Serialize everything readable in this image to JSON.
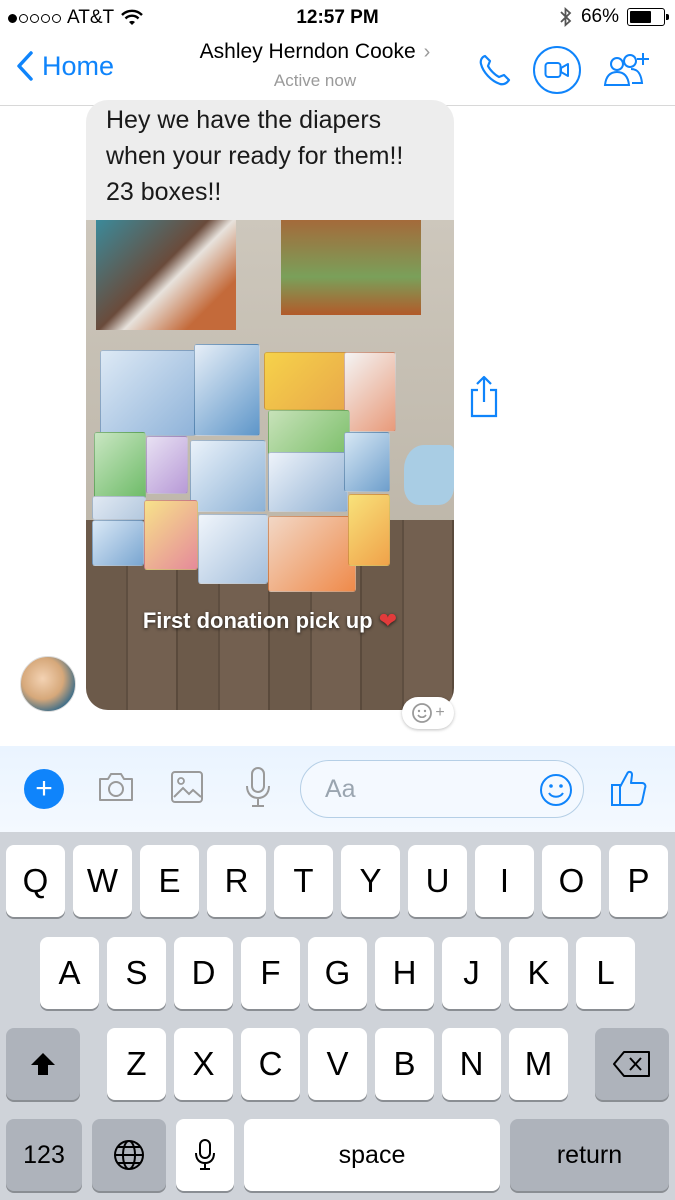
{
  "status": {
    "carrier": "AT&T",
    "time": "12:57 PM",
    "battery": "66%",
    "battery_level": 0.66
  },
  "header": {
    "back_label": "Home",
    "contact_name": "Ashley Herndon Cooke",
    "presence": "Active now"
  },
  "message": {
    "text": "Hey we have the diapers when your ready for them!! 23 boxes!!",
    "photo_caption": "First donation pick up"
  },
  "composer": {
    "placeholder": "Aa"
  },
  "keyboard": {
    "row1": [
      "Q",
      "W",
      "E",
      "R",
      "T",
      "Y",
      "U",
      "I",
      "O",
      "P"
    ],
    "row2": [
      "A",
      "S",
      "D",
      "F",
      "G",
      "H",
      "J",
      "K",
      "L"
    ],
    "row3": [
      "Z",
      "X",
      "C",
      "V",
      "B",
      "N",
      "M"
    ],
    "numbers_key": "123",
    "space_key": "space",
    "return_key": "return"
  },
  "colors": {
    "accent": "#0f84fb"
  }
}
